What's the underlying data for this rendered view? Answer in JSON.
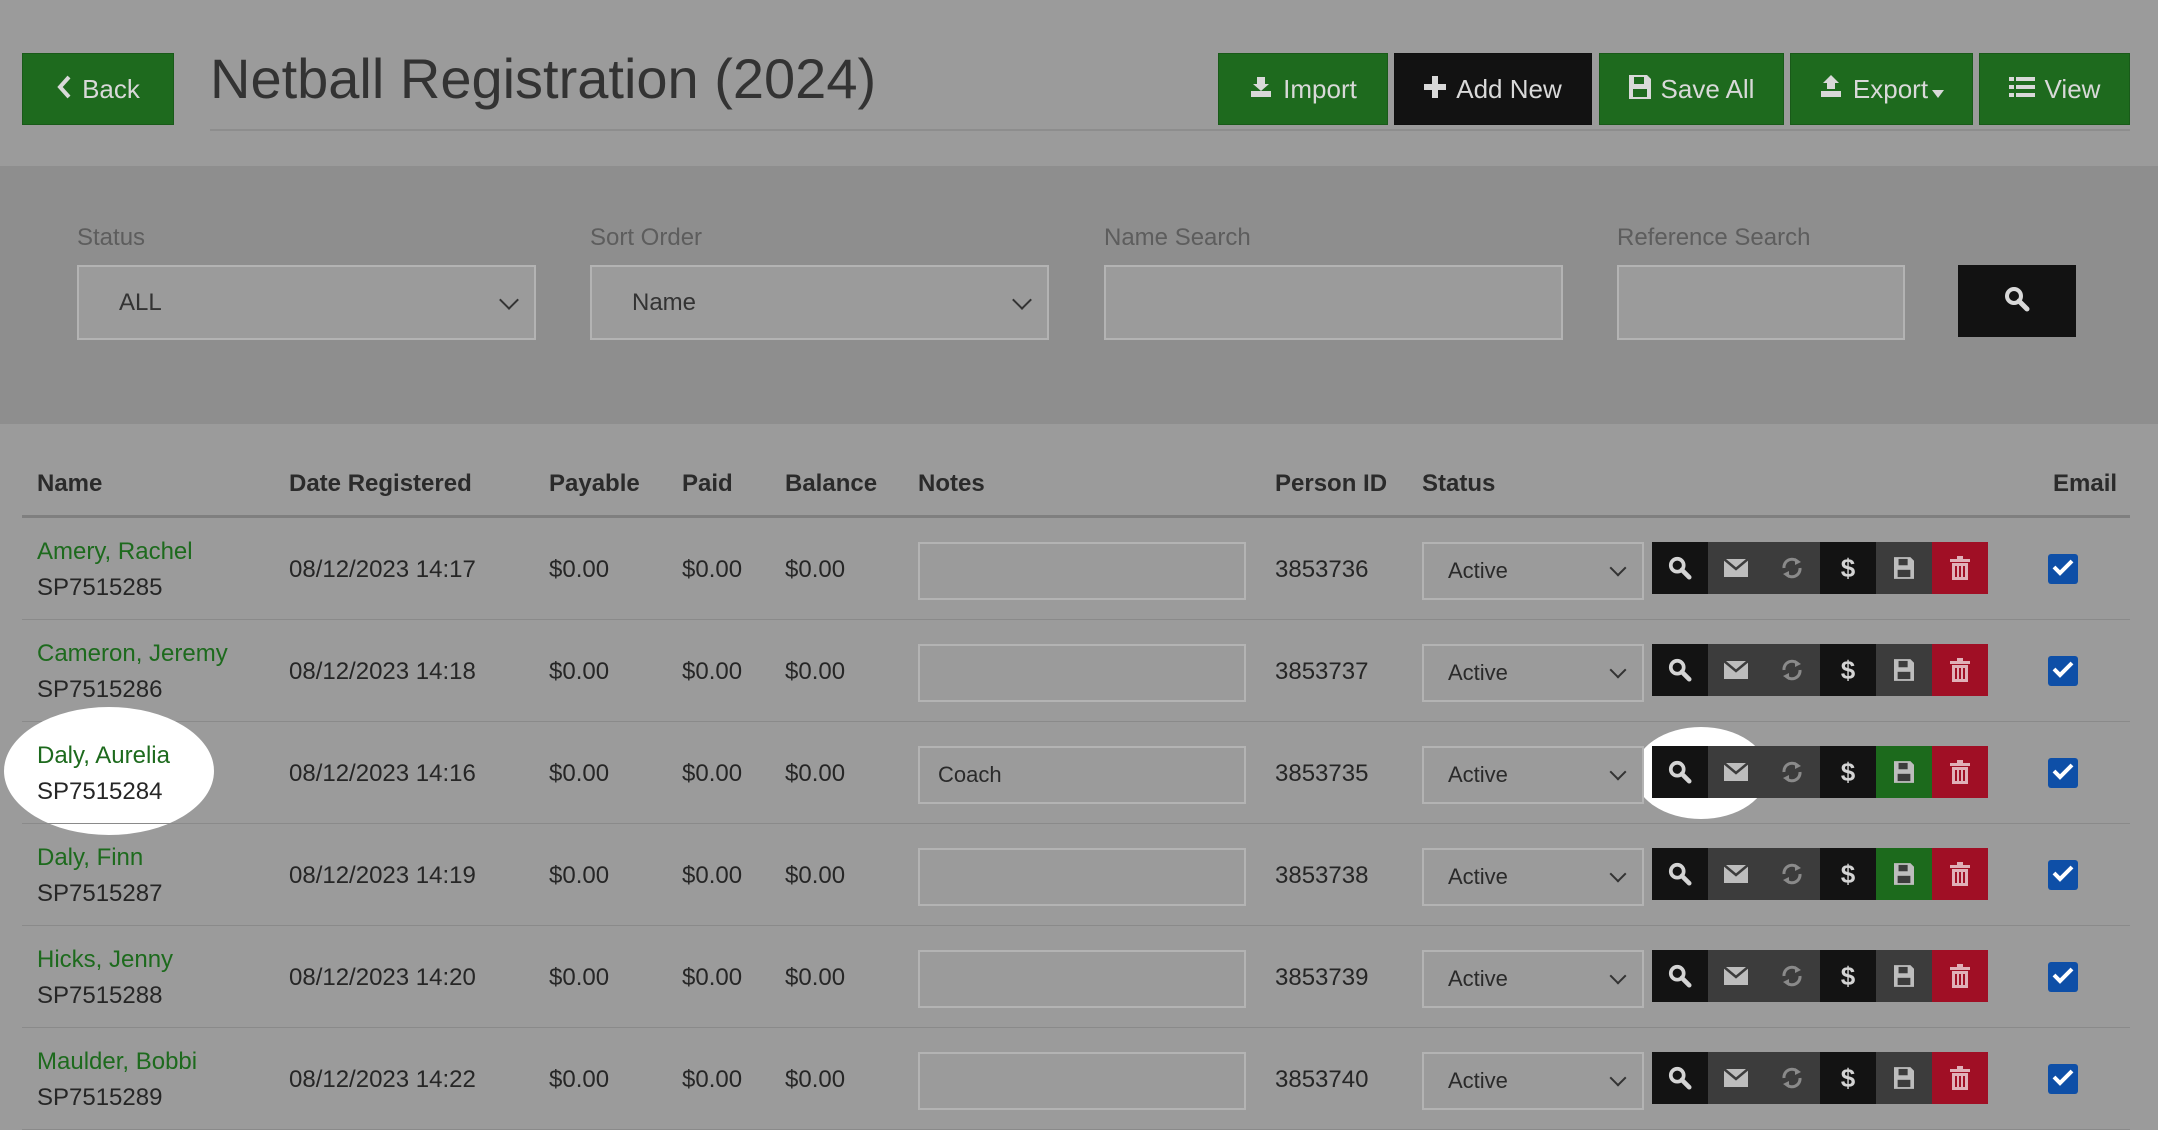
{
  "header": {
    "back_label": "Back",
    "title": "Netball Registration (2024)",
    "import_label": "Import",
    "add_new_label": "Add New",
    "save_all_label": "Save All",
    "export_label": "Export",
    "view_label": "View"
  },
  "filters": {
    "status_label": "Status",
    "status_value": "ALL",
    "sort_label": "Sort Order",
    "sort_value": "Name",
    "name_search_label": "Name Search",
    "name_search_value": "",
    "reference_search_label": "Reference Search",
    "reference_search_value": ""
  },
  "table": {
    "columns": {
      "name": "Name",
      "date": "Date Registered",
      "payable": "Payable",
      "paid": "Paid",
      "balance": "Balance",
      "notes": "Notes",
      "person_id": "Person ID",
      "status": "Status",
      "email": "Email"
    },
    "rows": [
      {
        "name": "Amery, Rachel",
        "ref": "SP7515285",
        "date": "08/12/2023 14:17",
        "payable": "$0.00",
        "paid": "$0.00",
        "balance": "$0.00",
        "notes": "",
        "person_id": "3853736",
        "status": "Active",
        "save_highlight": false,
        "email": true
      },
      {
        "name": "Cameron, Jeremy",
        "ref": "SP7515286",
        "date": "08/12/2023 14:18",
        "payable": "$0.00",
        "paid": "$0.00",
        "balance": "$0.00",
        "notes": "",
        "person_id": "3853737",
        "status": "Active",
        "save_highlight": false,
        "email": true
      },
      {
        "name": "Daly, Aurelia",
        "ref": "SP7515284",
        "date": "08/12/2023 14:16",
        "payable": "$0.00",
        "paid": "$0.00",
        "balance": "$0.00",
        "notes": "Coach",
        "person_id": "3853735",
        "status": "Active",
        "save_highlight": true,
        "email": true
      },
      {
        "name": "Daly, Finn",
        "ref": "SP7515287",
        "date": "08/12/2023 14:19",
        "payable": "$0.00",
        "paid": "$0.00",
        "balance": "$0.00",
        "notes": "",
        "person_id": "3853738",
        "status": "Active",
        "save_highlight": true,
        "email": true
      },
      {
        "name": "Hicks, Jenny",
        "ref": "SP7515288",
        "date": "08/12/2023 14:20",
        "payable": "$0.00",
        "paid": "$0.00",
        "balance": "$0.00",
        "notes": "",
        "person_id": "3853739",
        "status": "Active",
        "save_highlight": false,
        "email": true
      },
      {
        "name": "Maulder, Bobbi",
        "ref": "SP7515289",
        "date": "08/12/2023 14:22",
        "payable": "$0.00",
        "paid": "$0.00",
        "balance": "$0.00",
        "notes": "",
        "person_id": "3853740",
        "status": "Active",
        "save_highlight": false,
        "email": true
      }
    ]
  },
  "row_actions": [
    "search-icon",
    "envelope-icon",
    "refresh-icon",
    "dollar-icon",
    "save-icon",
    "trash-icon"
  ],
  "colors": {
    "brand_green": "#1e6a1e",
    "dark": "#121212",
    "danger": "#a00f25",
    "checkbox": "#0e4fa7",
    "link_green": "#1d6a1d"
  }
}
